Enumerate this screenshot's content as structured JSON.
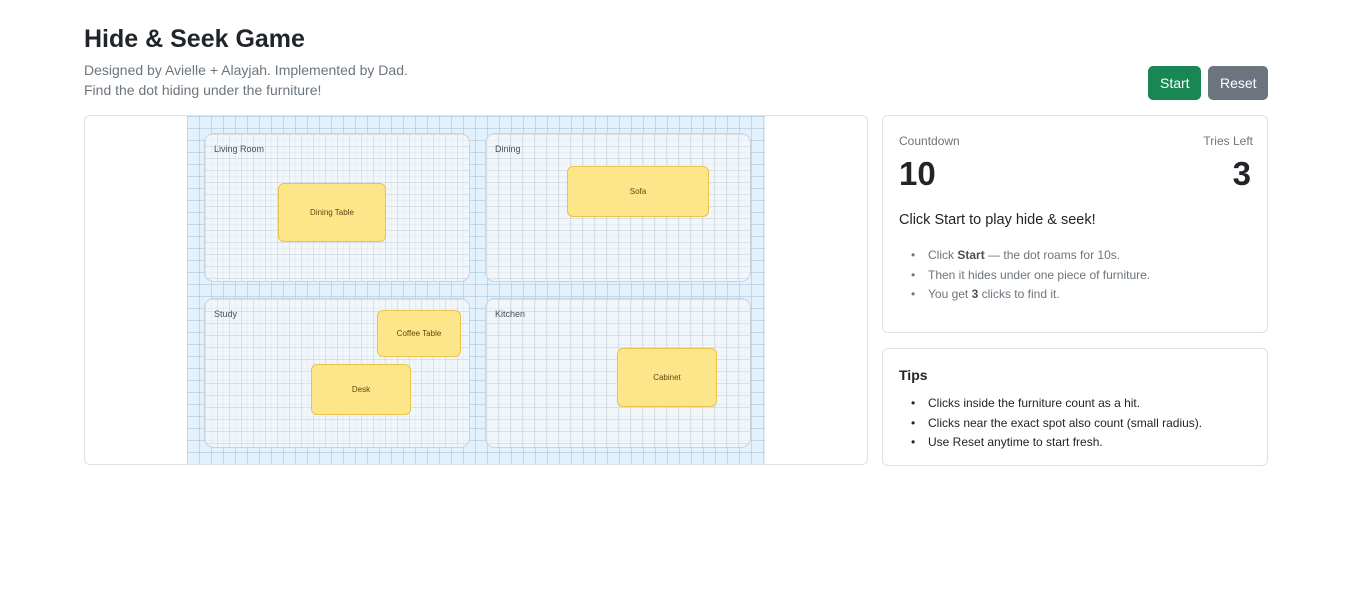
{
  "header": {
    "title": "Hide & Seek Game",
    "credit": "Designed by Avielle + Alayjah. Implemented by Dad.",
    "instruction": "Find the dot hiding under the furniture!"
  },
  "controls": {
    "start_label": "Start",
    "reset_label": "Reset"
  },
  "board": {
    "rooms": {
      "living_room": "Living Room",
      "dining": "Dining",
      "study": "Study",
      "kitchen": "Kitchen"
    },
    "furniture": {
      "dining_table": "Dining Table",
      "sofa": "Sofa",
      "coffee_table": "Coffee Table",
      "desk": "Desk",
      "cabinet": "Cabinet"
    }
  },
  "status": {
    "countdown_label": "Countdown",
    "countdown_value": "10",
    "tries_label": "Tries Left",
    "tries_value": "3",
    "message": "Click Start to play hide & seek!",
    "rules": {
      "r1_pre": "Click ",
      "r1_bold": "Start",
      "r1_post": " — the dot roams for 10s.",
      "r2": "Then it hides under one piece of furniture.",
      "r3_pre": "You get ",
      "r3_bold": "3",
      "r3_post": " clicks to find it."
    }
  },
  "tips": {
    "title": "Tips",
    "items": [
      "Clicks inside the furniture count as a hit.",
      "Clicks near the exact spot also count (small radius).",
      "Use Reset anytime to start fresh."
    ]
  },
  "colors": {
    "start_button": "#198754",
    "reset_button": "#6c757d",
    "furniture_fill": "#fde58a",
    "board_background": "#e3f1fc"
  }
}
